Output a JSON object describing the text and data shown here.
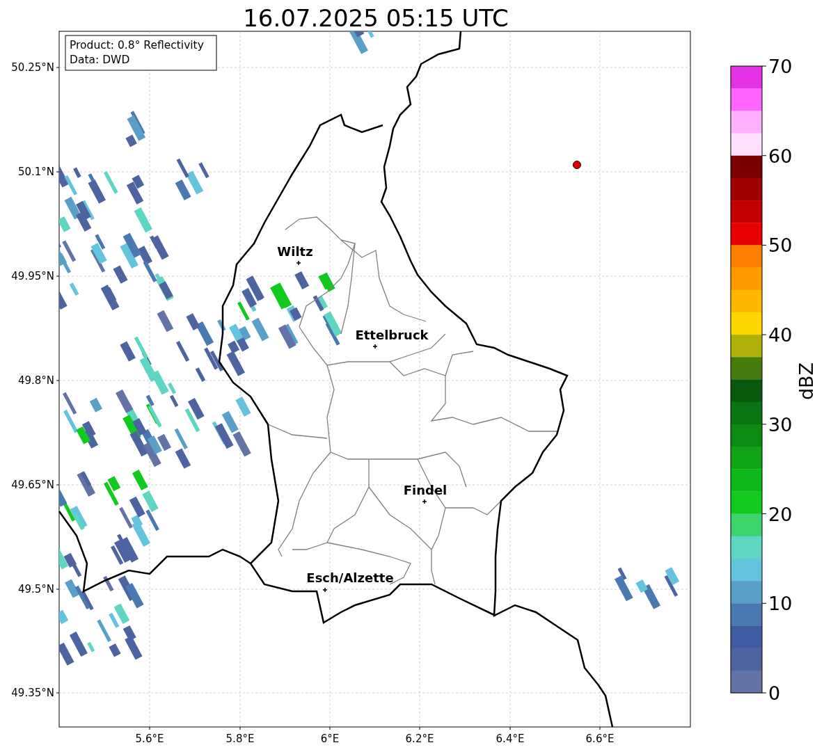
{
  "title": "16.07.2025 05:15 UTC",
  "info_box": [
    "Product: 0.8° Reflectivity",
    "Data: DWD"
  ],
  "y_ticks": [
    "50.25°N",
    "50.1°N",
    "49.95°N",
    "49.8°N",
    "49.65°N",
    "49.5°N",
    "49.35°N"
  ],
  "x_ticks": [
    "5.6°E",
    "5.8°E",
    "6°E",
    "6.2°E",
    "6.4°E",
    "6.6°E"
  ],
  "cities": [
    {
      "name": "Wiltz"
    },
    {
      "name": "Ettelbruck"
    },
    {
      "name": "Findel"
    },
    {
      "name": "Esch/Alzette"
    }
  ],
  "colorbar": {
    "label": "dBZ",
    "ticks": [
      "70",
      "60",
      "50",
      "40",
      "30",
      "20",
      "10",
      "0"
    ],
    "segments": [
      {
        "color": "#e632e6"
      },
      {
        "color": "#ff66ff"
      },
      {
        "color": "#ffb0ff"
      },
      {
        "color": "#ffe0ff"
      },
      {
        "color": "#7a0000"
      },
      {
        "color": "#a00000"
      },
      {
        "color": "#c00000"
      },
      {
        "color": "#e60000"
      },
      {
        "color": "#ff7f00"
      },
      {
        "color": "#ff9a00"
      },
      {
        "color": "#ffb800"
      },
      {
        "color": "#ffd700"
      },
      {
        "color": "#b0b00a"
      },
      {
        "color": "#457a0c"
      },
      {
        "color": "#08590e"
      },
      {
        "color": "#0a7312"
      },
      {
        "color": "#0c8a12"
      },
      {
        "color": "#0fa315"
      },
      {
        "color": "#0fb81a"
      },
      {
        "color": "#12c91e"
      },
      {
        "color": "#3dd46d"
      },
      {
        "color": "#5fd6c2"
      },
      {
        "color": "#65c4dd"
      },
      {
        "color": "#599fc8"
      },
      {
        "color": "#4a78b0"
      },
      {
        "color": "#3f5ca3"
      },
      {
        "color": "#4e64a0"
      },
      {
        "color": "#6373a6"
      }
    ]
  }
}
